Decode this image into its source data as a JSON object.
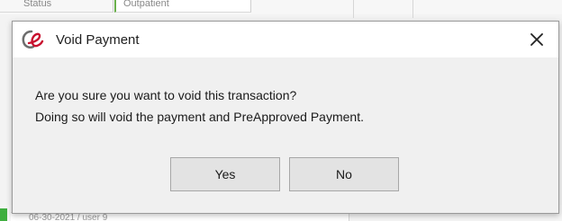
{
  "background": {
    "cell_a_text": "Status",
    "cell_b_text": "Outpatient",
    "bottom_cell_text": "06-30-2021 / user 9"
  },
  "dialog": {
    "title": "Void Payment",
    "icon": "app-logo-icon",
    "close_icon": "close-icon",
    "message_line1": "Are you sure you want to void this transaction?",
    "message_line2": "Doing so will void the payment and PreApproved Payment.",
    "yes_label": "Yes",
    "no_label": "No"
  },
  "colors": {
    "icon_red": "#c8102e",
    "icon_gray": "#6e6e6e",
    "accent_green": "#3fae3f"
  }
}
